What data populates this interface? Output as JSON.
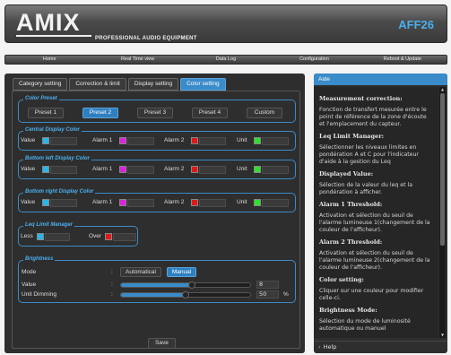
{
  "header": {
    "logo": "AMIX",
    "subtitle": "PROFESSIONAL AUDIO EQUIPMENT",
    "device": "AFF26"
  },
  "nav": {
    "items": [
      "Home",
      "Real Time view",
      "Data Log",
      "Configuration",
      "Reboot & Update"
    ]
  },
  "tabs": [
    {
      "label": "Category setting",
      "active": false
    },
    {
      "label": "Correction & limit",
      "active": false
    },
    {
      "label": "Display setting",
      "active": false
    },
    {
      "label": "Color setting",
      "active": true
    }
  ],
  "color_preset": {
    "title": "Color Preset",
    "buttons": [
      "Preset 1",
      "Preset 2",
      "Preset 3",
      "Preset 4",
      "Custom"
    ],
    "selected": "Preset 2"
  },
  "central_display": {
    "title": "Central Display Color",
    "value_label": "Value",
    "value_color": "#29b6e8",
    "alarm1_label": "Alarm 1",
    "alarm1_color": "#e020e0",
    "alarm2_label": "Alarm 2",
    "alarm2_color": "#e01818",
    "unit_label": "Unit",
    "unit_color": "#2ee02e"
  },
  "bottom_left_display": {
    "title": "Bottom left Display Color",
    "value_label": "Value",
    "value_color": "#29b6e8",
    "alarm1_label": "Alarm 1",
    "alarm1_color": "#e020e0",
    "alarm2_label": "Alarm 2",
    "alarm2_color": "#e01818",
    "unit_label": "Unit",
    "unit_color": "#2ee02e"
  },
  "bottom_right_display": {
    "title": "Bottom right Display Color",
    "value_label": "Value",
    "value_color": "#29b6e8",
    "alarm1_label": "Alarm 1",
    "alarm1_color": "#e020e0",
    "alarm2_label": "Alarm 2",
    "alarm2_color": "#e01818",
    "unit_label": "Unit",
    "unit_color": "#2ee02e"
  },
  "leq_limit": {
    "title": "Leq Limit Manager",
    "less_label": "Less",
    "less_color": "#29b6e8",
    "over_label": "Over",
    "over_color": "#e01818"
  },
  "brightness": {
    "title": "Brightness",
    "mode_label": "Mode",
    "separator": ":",
    "mode_options": [
      "Automatical",
      "Manual"
    ],
    "mode_selected": "Manual",
    "value_label": "Value",
    "value": "8",
    "value_fraction": 0.55,
    "dimming_label": "Unit Dimming",
    "dimming": "50",
    "dimming_fraction": 0.5,
    "dimming_unit": "%"
  },
  "save_label": "Save",
  "help": {
    "header": "Aide",
    "footer": "Help",
    "sections": [
      {
        "title": "Measurement correction:",
        "text": "Fonction de transfert mesurée entre le point de référence de la zone d'écoute et l'emplacement du capteur."
      },
      {
        "title": "Leq Limit Manager:",
        "text": "Sélectionner les niveaux limites en pondération A et C pour l'indicateur d'aide à la gestion du Leq"
      },
      {
        "title": "Displayed Value:",
        "text": "Sélection de la valeur du leq et la pondération à afficher."
      },
      {
        "title": "Alarm 1 Threshold:",
        "text": "Activation et sélection du seuil de l'alarme lumineuse 1(changement de la couleur de l'afficheur)."
      },
      {
        "title": "Alarm 2 Threshold:",
        "text": "Activation et sélection du seuil de l'alarme lumineuse 2(changement de la couleur de l'afficheur)."
      },
      {
        "title": "Color setting:",
        "text": "Cliquer sur une couleur pour modifier celle-ci."
      },
      {
        "title": "Brightness Mode:",
        "text": "Sélection du mode de luminosité automatique ou manuel"
      }
    ]
  },
  "accent_color": "#3a8bc9"
}
